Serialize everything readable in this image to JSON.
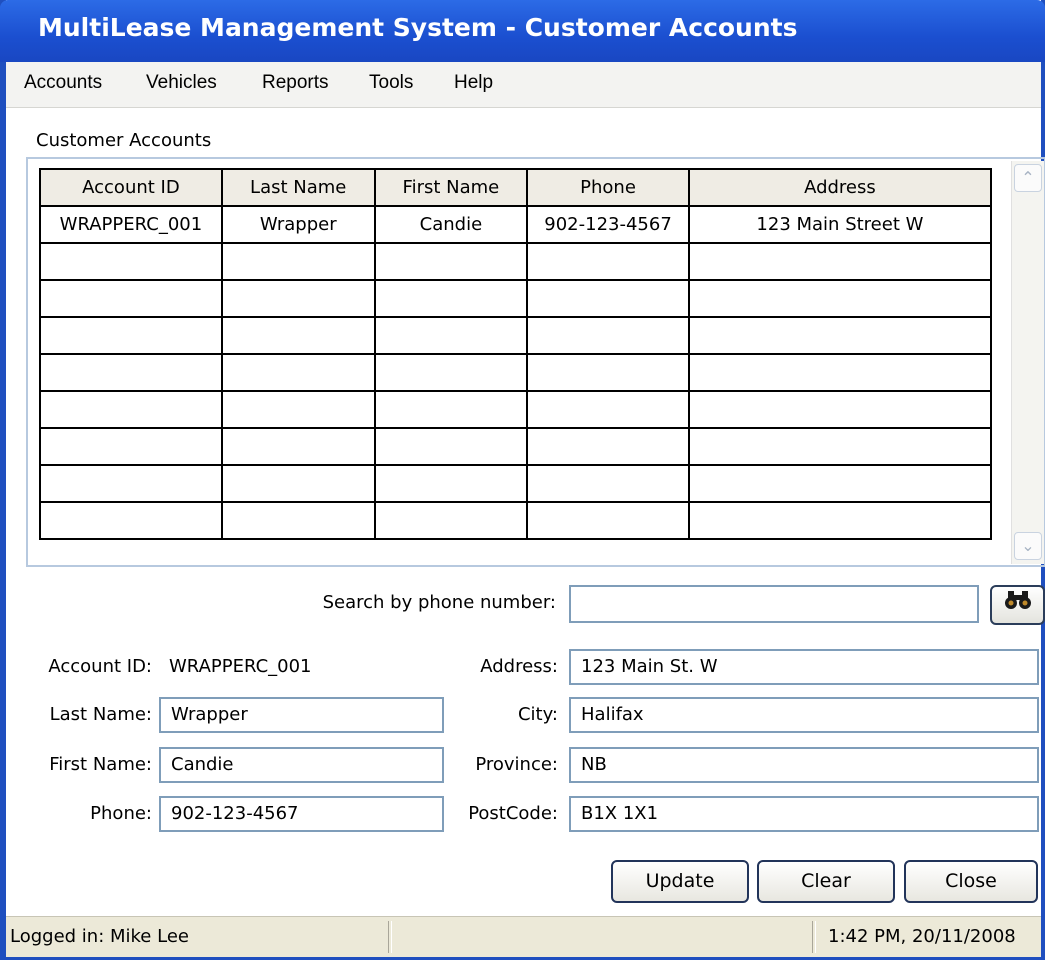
{
  "window": {
    "title": "MultiLease Management System - Customer Accounts"
  },
  "menu": [
    "Accounts",
    "Vehicles",
    "Reports",
    "Tools",
    "Help"
  ],
  "section_label": "Customer Accounts",
  "table": {
    "columns": [
      "Account ID",
      "Last Name",
      "First Name",
      "Phone",
      "Address"
    ],
    "rows": [
      [
        "WRAPPERC_001",
        "Wrapper",
        "Candie",
        "902-123-4567",
        "123 Main Street W"
      ]
    ],
    "empty_rows": 8
  },
  "search": {
    "label": "Search by phone number:",
    "value": "",
    "button_icon": "binoculars-icon"
  },
  "form": {
    "account_id_label": "Account ID:",
    "account_id_value": "WRAPPERC_001",
    "last_name_label": "Last Name:",
    "last_name_value": "Wrapper",
    "first_name_label": "First Name:",
    "first_name_value": "Candie",
    "phone_label": "Phone:",
    "phone_value": "902-123-4567",
    "address_label": "Address:",
    "address_value": "123 Main St. W",
    "city_label": "City:",
    "city_value": "Halifax",
    "province_label": "Province:",
    "province_value": "NB",
    "postcode_label": "PostCode:",
    "postcode_value": "B1X 1X1"
  },
  "buttons": {
    "update": "Update",
    "clear": "Clear",
    "close": "Close"
  },
  "status": {
    "user": "Logged in: Mike Lee",
    "middle": "",
    "datetime": "1:42 PM, 20/11/2008"
  },
  "colors": {
    "titlebar": "#1b4fd0",
    "window_border": "#1f4fbf",
    "header_bg": "#efece4",
    "statusbar": "#ece9d8"
  }
}
